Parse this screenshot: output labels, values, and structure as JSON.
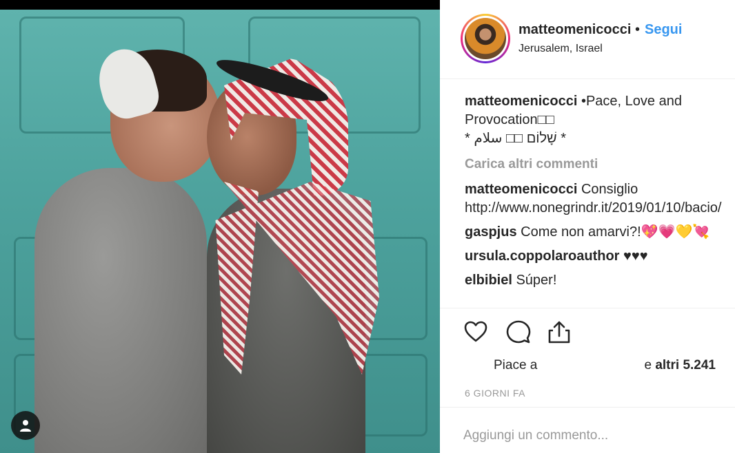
{
  "post": {
    "username": "matteomenicocci",
    "separator": "•",
    "follow_label": "Segui",
    "location": "Jerusalem, Israel"
  },
  "caption": {
    "user": "matteomenicocci",
    "line1": " •Pace, Love and",
    "line2": "Provocation□□",
    "line3": "* שָׁלוֹם □□ سلام *"
  },
  "load_more": "Carica altri commenti",
  "comments": [
    {
      "user": "matteomenicocci",
      "text": " Consiglio http://www.nonegrindr.it/2019/01/10/bacio/"
    },
    {
      "user": "gaspjus",
      "text": " Come non amarvi?!💖💗💛💘"
    },
    {
      "user": "ursula.coppolaroauthor",
      "text": " ♥♥♥"
    },
    {
      "user": "elbibiel",
      "text": " Súper!"
    }
  ],
  "likes": {
    "prefix": "Piace a",
    "suffix_lead": "e ",
    "suffix_bold": "altri 5.241"
  },
  "timestamp": "6 GIORNI FA",
  "add_comment": {
    "placeholder": "Aggiungi un commento..."
  },
  "icons": [
    "heart-icon",
    "comment-icon",
    "share-icon",
    "user-icon"
  ],
  "colors": {
    "link": "#3897f0",
    "muted": "#999999",
    "text": "#262626"
  }
}
